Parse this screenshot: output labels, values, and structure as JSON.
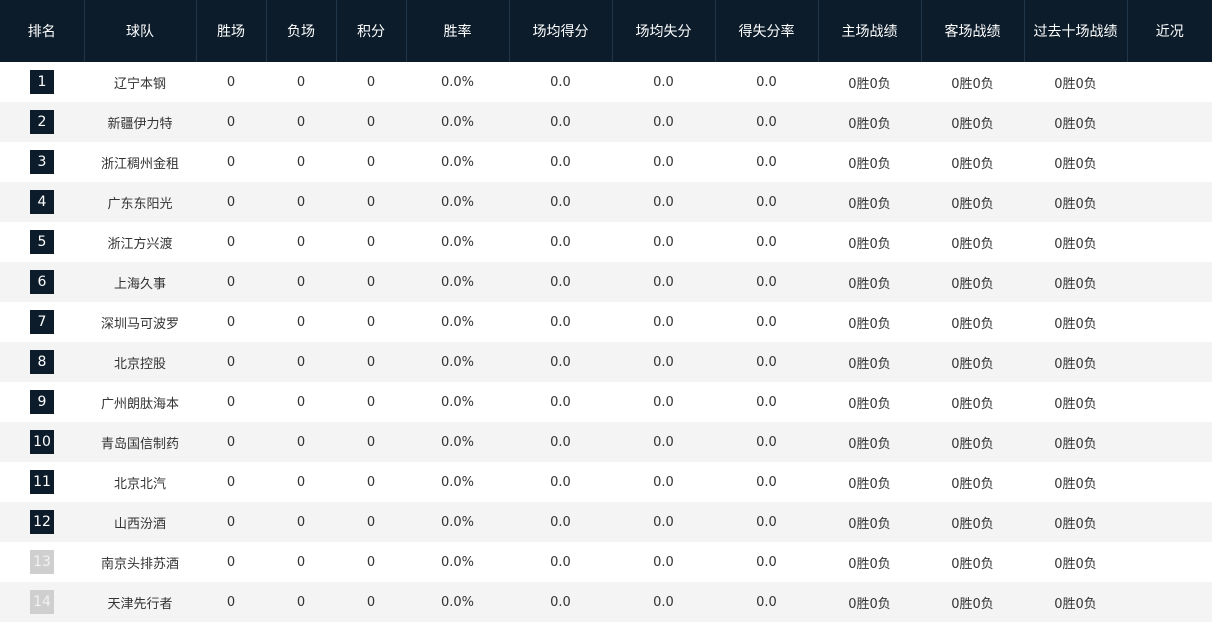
{
  "table": {
    "headers": [
      "排名",
      "球队",
      "胜场",
      "负场",
      "积分",
      "胜率",
      "场均得分",
      "场均失分",
      "得失分率",
      "主场战绩",
      "客场战绩",
      "过去十场战绩",
      "近况"
    ],
    "rows": [
      {
        "rank": "1",
        "team": "辽宁本钢",
        "wins": "0",
        "losses": "0",
        "points": "0",
        "win_rate": "0.0%",
        "avg_scored": "0.0",
        "avg_allowed": "0.0",
        "ratio": "0.0",
        "home": "0胜0负",
        "away": "0胜0负",
        "last10": "0胜0负",
        "recent": ""
      },
      {
        "rank": "2",
        "team": "新疆伊力特",
        "wins": "0",
        "losses": "0",
        "points": "0",
        "win_rate": "0.0%",
        "avg_scored": "0.0",
        "avg_allowed": "0.0",
        "ratio": "0.0",
        "home": "0胜0负",
        "away": "0胜0负",
        "last10": "0胜0负",
        "recent": ""
      },
      {
        "rank": "3",
        "team": "浙江稠州金租",
        "wins": "0",
        "losses": "0",
        "points": "0",
        "win_rate": "0.0%",
        "avg_scored": "0.0",
        "avg_allowed": "0.0",
        "ratio": "0.0",
        "home": "0胜0负",
        "away": "0胜0负",
        "last10": "0胜0负",
        "recent": ""
      },
      {
        "rank": "4",
        "team": "广东东阳光",
        "wins": "0",
        "losses": "0",
        "points": "0",
        "win_rate": "0.0%",
        "avg_scored": "0.0",
        "avg_allowed": "0.0",
        "ratio": "0.0",
        "home": "0胜0负",
        "away": "0胜0负",
        "last10": "0胜0负",
        "recent": ""
      },
      {
        "rank": "5",
        "team": "浙江方兴渡",
        "wins": "0",
        "losses": "0",
        "points": "0",
        "win_rate": "0.0%",
        "avg_scored": "0.0",
        "avg_allowed": "0.0",
        "ratio": "0.0",
        "home": "0胜0负",
        "away": "0胜0负",
        "last10": "0胜0负",
        "recent": ""
      },
      {
        "rank": "6",
        "team": "上海久事",
        "wins": "0",
        "losses": "0",
        "points": "0",
        "win_rate": "0.0%",
        "avg_scored": "0.0",
        "avg_allowed": "0.0",
        "ratio": "0.0",
        "home": "0胜0负",
        "away": "0胜0负",
        "last10": "0胜0负",
        "recent": ""
      },
      {
        "rank": "7",
        "team": "深圳马可波罗",
        "wins": "0",
        "losses": "0",
        "points": "0",
        "win_rate": "0.0%",
        "avg_scored": "0.0",
        "avg_allowed": "0.0",
        "ratio": "0.0",
        "home": "0胜0负",
        "away": "0胜0负",
        "last10": "0胜0负",
        "recent": ""
      },
      {
        "rank": "8",
        "team": "北京控股",
        "wins": "0",
        "losses": "0",
        "points": "0",
        "win_rate": "0.0%",
        "avg_scored": "0.0",
        "avg_allowed": "0.0",
        "ratio": "0.0",
        "home": "0胜0负",
        "away": "0胜0负",
        "last10": "0胜0负",
        "recent": ""
      },
      {
        "rank": "9",
        "team": "广州朗肽海本",
        "wins": "0",
        "losses": "0",
        "points": "0",
        "win_rate": "0.0%",
        "avg_scored": "0.0",
        "avg_allowed": "0.0",
        "ratio": "0.0",
        "home": "0胜0负",
        "away": "0胜0负",
        "last10": "0胜0负",
        "recent": ""
      },
      {
        "rank": "10",
        "team": "青岛国信制药",
        "wins": "0",
        "losses": "0",
        "points": "0",
        "win_rate": "0.0%",
        "avg_scored": "0.0",
        "avg_allowed": "0.0",
        "ratio": "0.0",
        "home": "0胜0负",
        "away": "0胜0负",
        "last10": "0胜0负",
        "recent": ""
      },
      {
        "rank": "11",
        "team": "北京北汽",
        "wins": "0",
        "losses": "0",
        "points": "0",
        "win_rate": "0.0%",
        "avg_scored": "0.0",
        "avg_allowed": "0.0",
        "ratio": "0.0",
        "home": "0胜0负",
        "away": "0胜0负",
        "last10": "0胜0负",
        "recent": ""
      },
      {
        "rank": "12",
        "team": "山西汾酒",
        "wins": "0",
        "losses": "0",
        "points": "0",
        "win_rate": "0.0%",
        "avg_scored": "0.0",
        "avg_allowed": "0.0",
        "ratio": "0.0",
        "home": "0胜0负",
        "away": "0胜0负",
        "last10": "0胜0负",
        "recent": ""
      },
      {
        "rank": "13",
        "team": "南京头排苏酒",
        "wins": "0",
        "losses": "0",
        "points": "0",
        "win_rate": "0.0%",
        "avg_scored": "0.0",
        "avg_allowed": "0.0",
        "ratio": "0.0",
        "home": "0胜0负",
        "away": "0胜0负",
        "last10": "0胜0负",
        "recent": "",
        "dim": true
      },
      {
        "rank": "14",
        "team": "天津先行者",
        "wins": "0",
        "losses": "0",
        "points": "0",
        "win_rate": "0.0%",
        "avg_scored": "0.0",
        "avg_allowed": "0.0",
        "ratio": "0.0",
        "home": "0胜0负",
        "away": "0胜0负",
        "last10": "0胜0负",
        "recent": "",
        "dim": true
      }
    ]
  },
  "colors": {
    "header_bg": "#0c1c2b",
    "rank_badge_top": "#0c1c2b",
    "rank_badge_dim": "#cfcfcf",
    "row_alt_bg": "#f4f4f4"
  }
}
